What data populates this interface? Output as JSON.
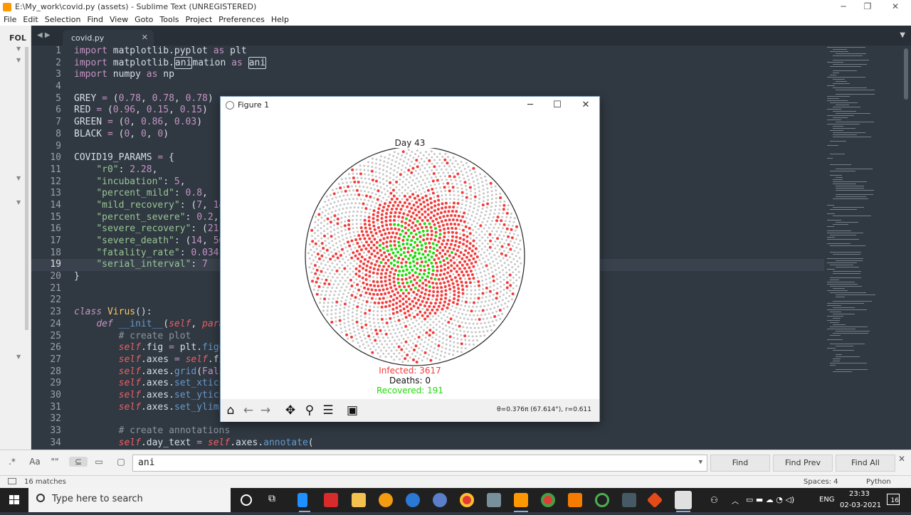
{
  "window": {
    "title": "E:\\My_work\\covid.py (assets) - Sublime Text (UNREGISTERED)",
    "minimize": "─",
    "maximize": "❐",
    "close": "✕"
  },
  "menu": [
    "File",
    "Edit",
    "Selection",
    "Find",
    "View",
    "Goto",
    "Tools",
    "Project",
    "Preferences",
    "Help"
  ],
  "sidebar": {
    "label": "FOL"
  },
  "tab": {
    "name": "covid.py",
    "close": "✕"
  },
  "editor": {
    "line_numbers": [
      "1",
      "2",
      "3",
      "4",
      "5",
      "6",
      "7",
      "8",
      "9",
      "10",
      "11",
      "12",
      "13",
      "14",
      "15",
      "16",
      "17",
      "18",
      "19",
      "20",
      "21",
      "22",
      "23",
      "24",
      "25",
      "26",
      "27",
      "28",
      "29",
      "30",
      "31",
      "32",
      "33",
      "34"
    ],
    "current_line": "19"
  },
  "figure": {
    "title": "Figure 1",
    "plot_title": "Day 43",
    "infected": "Infected: 3617",
    "deaths": "Deaths: 0",
    "recovered": "Recovered: 191",
    "coord_readout": "θ=0.376π (67.614°), r=0.611",
    "colors": {
      "infected": "#f23c3c",
      "recovered": "#1edb08",
      "susceptible": "#c7c7c7",
      "deaths": "#000000"
    },
    "tools": [
      "home-icon",
      "back-icon",
      "forward-icon",
      "pan-icon",
      "zoom-icon",
      "configure-icon",
      "save-icon"
    ]
  },
  "find": {
    "query": "ani",
    "find_label": "Find",
    "find_prev_label": "Find Prev",
    "find_all_label": "Find All",
    "close": "✕",
    "options": [
      ".*",
      "Aa",
      "\"\"",
      "⊆",
      "▭",
      "▢"
    ]
  },
  "status": {
    "matches": "16 matches",
    "spaces": "Spaces: 4",
    "syntax": "Python"
  },
  "taskbar": {
    "search_placeholder": "Type here to search",
    "language": "ENG",
    "time": "23:33",
    "date": "02-03-2021",
    "notifications": "16"
  }
}
